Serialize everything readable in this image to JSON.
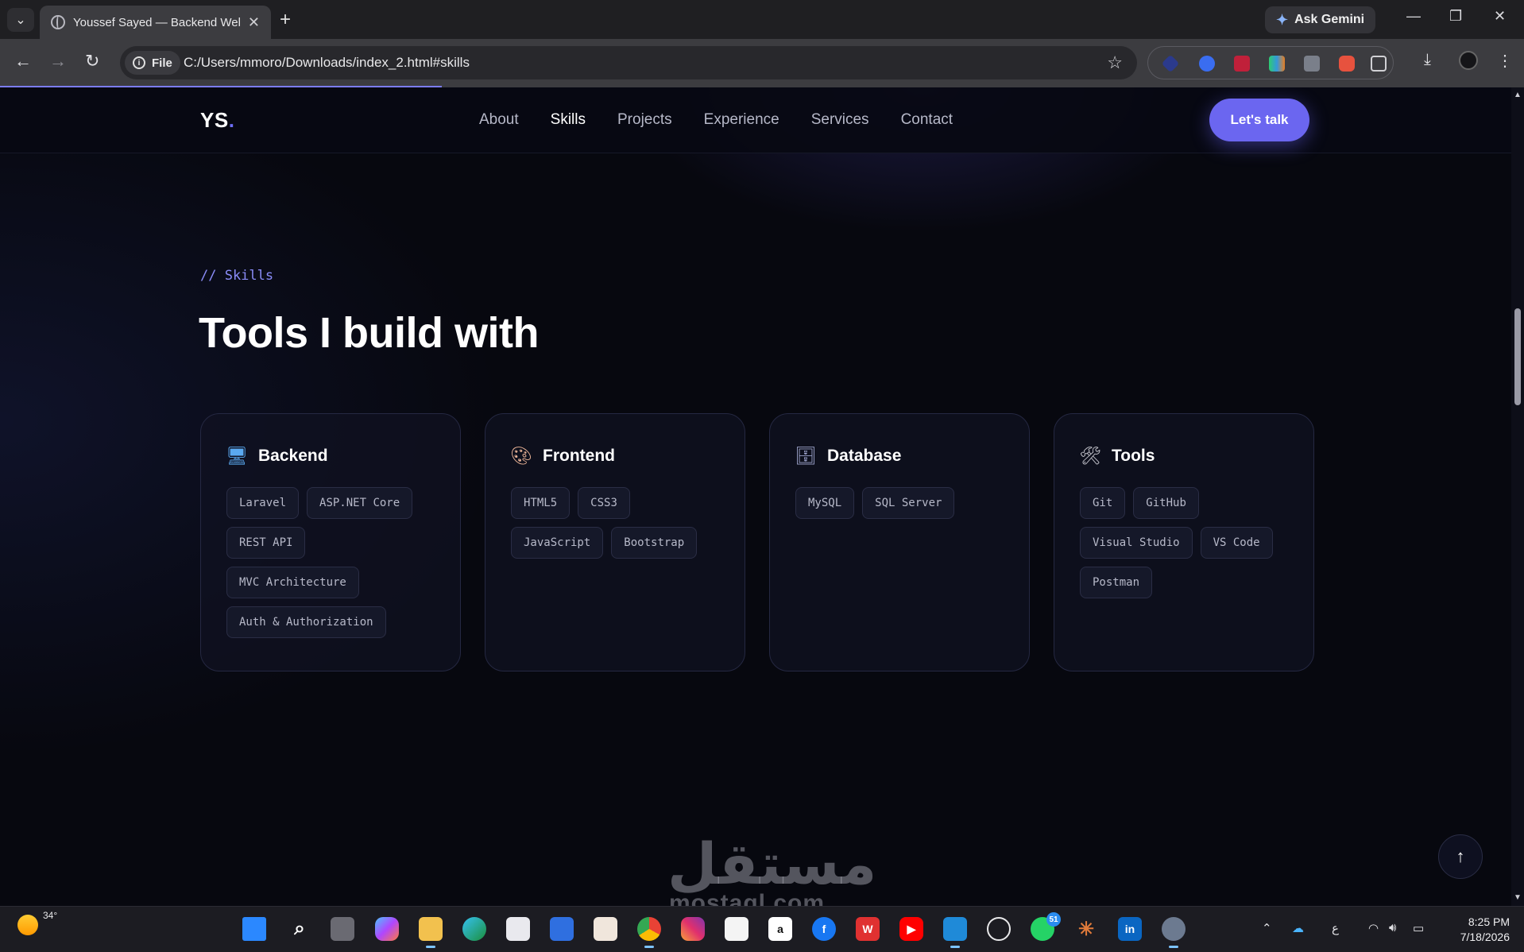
{
  "browser": {
    "tab_title": "Youssef Sayed — Backend Web",
    "ask_gemini": "Ask Gemini",
    "file_chip": "File",
    "url": "C:/Users/mmoro/Downloads/index_2.html#skills",
    "page_load_progress": 0.29
  },
  "site": {
    "logo": "YS",
    "logo_dot": ".",
    "nav": [
      "About",
      "Skills",
      "Projects",
      "Experience",
      "Services",
      "Contact"
    ],
    "active_nav": "Skills",
    "cta": "Let's talk",
    "accent_color": "#6b66f0"
  },
  "skills": {
    "eyebrow": "// Skills",
    "heading": "Tools I build with",
    "cards": [
      {
        "icon": "computer-icon",
        "title": "Backend",
        "chips": [
          "Laravel",
          "ASP.NET Core",
          "REST API",
          "MVC Architecture",
          "Auth & Authorization"
        ]
      },
      {
        "icon": "palette-icon",
        "title": "Frontend",
        "chips": [
          "HTML5",
          "CSS3",
          "JavaScript",
          "Bootstrap"
        ]
      },
      {
        "icon": "file-cabinet-icon",
        "title": "Database",
        "chips": [
          "MySQL",
          "SQL Server"
        ]
      },
      {
        "icon": "hammer-wrench-icon",
        "title": "Tools",
        "chips": [
          "Git",
          "GitHub",
          "Visual Studio",
          "VS Code",
          "Postman"
        ]
      }
    ]
  },
  "watermark": {
    "text": "مستقل",
    "sub": "mostaql.com"
  },
  "taskbar": {
    "weather_temp": "34°",
    "whatsapp_badge": "51",
    "ime": "ع",
    "time": "8:25 PM",
    "date": "7/18/2026"
  }
}
